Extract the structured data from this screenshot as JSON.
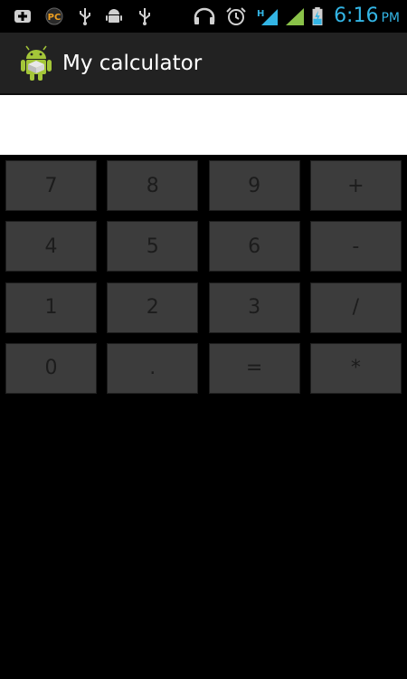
{
  "status_bar": {
    "time": "6:16",
    "ampm": "PM",
    "icons": [
      "add-notification-icon",
      "pc-connect-icon",
      "usb-icon",
      "android-debug-icon",
      "usb-icon",
      "headphones-icon",
      "alarm-icon",
      "data-signal-icon",
      "cell-signal-icon",
      "battery-charging-icon"
    ],
    "accent_color": "#33b5e5"
  },
  "action_bar": {
    "title": "My calculator",
    "icon": "android-app-icon"
  },
  "display": {
    "value": ""
  },
  "keypad": {
    "rows": [
      [
        "7",
        "8",
        "9",
        "+"
      ],
      [
        "4",
        "5",
        "6",
        "-"
      ],
      [
        "1",
        "2",
        "3",
        "/"
      ],
      [
        "0",
        ".",
        "=",
        "*"
      ]
    ]
  }
}
